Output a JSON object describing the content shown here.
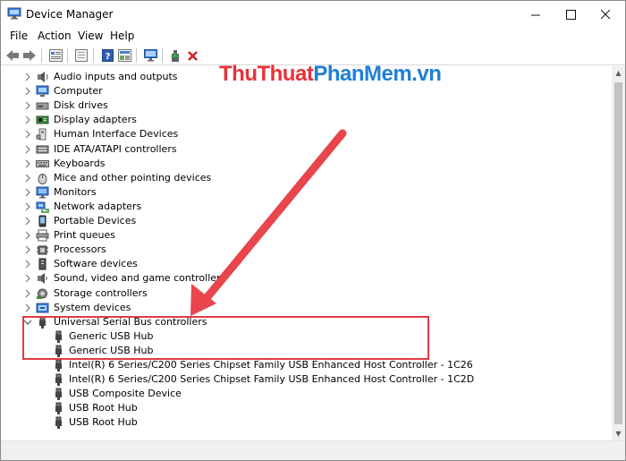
{
  "window": {
    "title": "Device Manager",
    "minimize_glyph": "—",
    "maximize_glyph": "☐",
    "close_glyph": "✕"
  },
  "menu": {
    "file": "File",
    "action": "Action",
    "view": "View",
    "help": "Help"
  },
  "toolbar": {
    "icons": [
      "back-icon",
      "forward-icon",
      "properties-icon",
      "show-hidden-icon",
      "help-icon",
      "view-icon",
      "scan-hardware-icon",
      "update-driver-icon",
      "uninstall-icon"
    ]
  },
  "watermark": {
    "part1": "Thu",
    "part2": "Thuat",
    "part3": "PhanMem",
    "part4": ".vn",
    "colors": [
      "#e8323a",
      "#e8323a",
      "#1f7fd6",
      "#1f7fd6"
    ]
  },
  "tree": {
    "categories": [
      {
        "label": "Audio inputs and outputs",
        "icon": "speaker-icon"
      },
      {
        "label": "Computer",
        "icon": "computer-icon"
      },
      {
        "label": "Disk drives",
        "icon": "disk-drive-icon"
      },
      {
        "label": "Display adapters",
        "icon": "display-adapter-icon"
      },
      {
        "label": "Human Interface Devices",
        "icon": "hid-icon"
      },
      {
        "label": "IDE ATA/ATAPI controllers",
        "icon": "ide-controller-icon"
      },
      {
        "label": "Keyboards",
        "icon": "keyboard-icon"
      },
      {
        "label": "Mice and other pointing devices",
        "icon": "mouse-icon"
      },
      {
        "label": "Monitors",
        "icon": "monitor-icon"
      },
      {
        "label": "Network adapters",
        "icon": "network-adapter-icon"
      },
      {
        "label": "Portable Devices",
        "icon": "portable-device-icon"
      },
      {
        "label": "Print queues",
        "icon": "printer-icon"
      },
      {
        "label": "Processors",
        "icon": "processor-icon"
      },
      {
        "label": "Software devices",
        "icon": "software-device-icon"
      },
      {
        "label": "Sound, video and game controllers",
        "icon": "sound-controller-icon"
      },
      {
        "label": "Storage controllers",
        "icon": "storage-controller-icon"
      },
      {
        "label": "System devices",
        "icon": "system-device-icon"
      },
      {
        "label": "Universal Serial Bus controllers",
        "icon": "usb-icon"
      }
    ],
    "usb_children": [
      "Generic USB Hub",
      "Generic USB Hub",
      "Intel(R) 6 Series/C200 Series Chipset Family USB Enhanced Host Controller - 1C26",
      "Intel(R) 6 Series/C200 Series Chipset Family USB Enhanced Host Controller - 1C2D",
      "USB Composite Device",
      "USB Root Hub",
      "USB Root Hub"
    ]
  },
  "annotation": {
    "color": "#e03c44"
  }
}
